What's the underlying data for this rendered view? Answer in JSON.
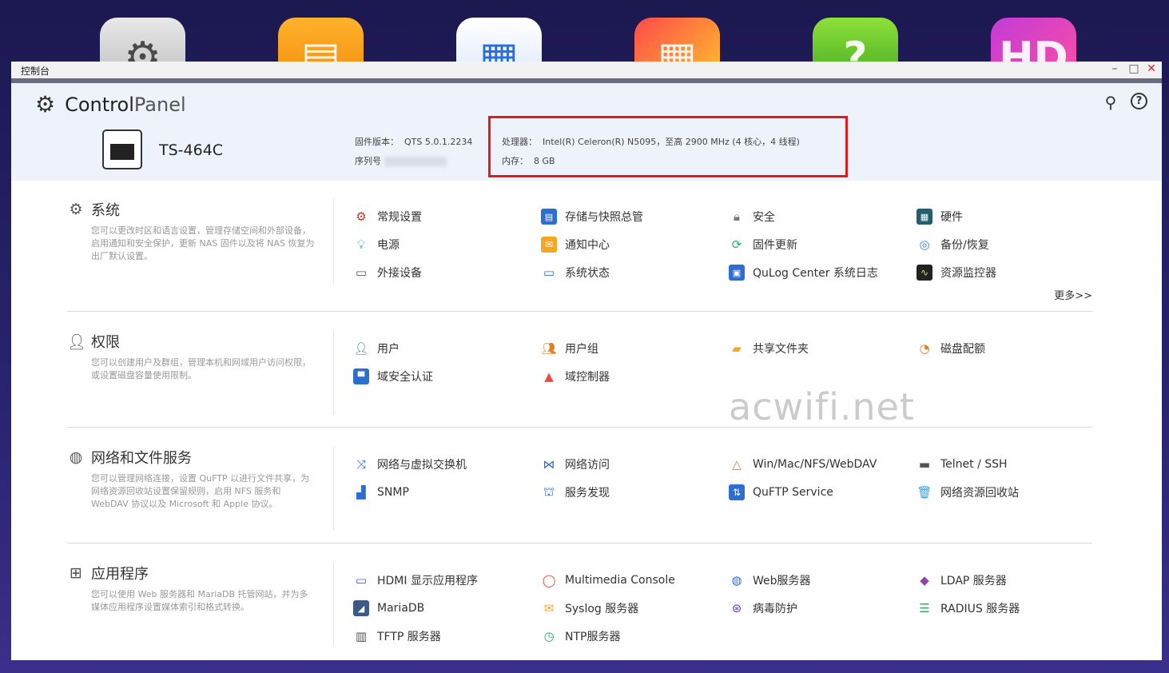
{
  "desktop": {
    "icons": [
      "gear-icon",
      "folder-icon",
      "storage-icon",
      "app-center-icon",
      "help-icon",
      "hd-icon"
    ],
    "glyphs": [
      "⚙",
      "▤",
      "▦",
      "▦",
      "?",
      "HD"
    ]
  },
  "window": {
    "title": "控制台",
    "min": "–",
    "max": "□",
    "close": "✕"
  },
  "header": {
    "brand_bold": "Control",
    "brand_light": "Panel",
    "device_name": "TS-464C",
    "fw_label": "固件版本：",
    "fw_value": "QTS 5.0.1.2234",
    "sn_label": "序列号",
    "cpu_label": "处理器：",
    "cpu_value": "Intel(R) Celeron(R) N5095，至高 2900 MHz (4 核心，4 线程)",
    "mem_label": "内存：",
    "mem_value": "8 GB"
  },
  "sections": [
    {
      "title": "系统",
      "desc": "您可以更改时区和语言设置，管理存储空间和外部设备，启用通知和安全保护，更新 NAS 固件以及将 NAS 恢复为出厂默认设置。",
      "items": [
        "常规设置",
        "存储与快照总管",
        "安全",
        "硬件",
        "电源",
        "通知中心",
        "固件更新",
        "备份/恢复",
        "外接设备",
        "系统状态",
        "QuLog Center 系统日志",
        "资源监控器"
      ],
      "more": "更多>>"
    },
    {
      "title": "权限",
      "desc": "您可以创建用户及群组，管理本机和网域用户访问权限，或设置磁盘容量使用限制。",
      "items": [
        "用户",
        "用户组",
        "共享文件夹",
        "磁盘配额",
        "域安全认证",
        "域控制器"
      ]
    },
    {
      "title": "网络和文件服务",
      "desc": "您可以管理网络连接，设置 QuFTP 以进行文件共享，为网络资源回收站设置保留规则，启用 NFS 服务和 WebDAV 协议以及 Microsoft 和 Apple 协议。",
      "items": [
        "网络与虚拟交换机",
        "网络访问",
        "Win/Mac/NFS/WebDAV",
        "Telnet / SSH",
        "SNMP",
        "服务发现",
        "QuFTP Service",
        "网络资源回收站"
      ]
    },
    {
      "title": "应用程序",
      "desc": "您可以使用 Web 服务器和 MariaDB 托管网站，并为多媒体应用程序设置媒体索引和格式转换。",
      "items": [
        "HDMI 显示应用程序",
        "Multimedia Console",
        "Web服务器",
        "LDAP 服务器",
        "MariaDB",
        "Syslog 服务器",
        "病毒防护",
        "RADIUS 服务器",
        "TFTP 服务器",
        "NTP服务器"
      ]
    }
  ],
  "watermark": "acwifi.net",
  "colors": {
    "highlight": "#e11a1a",
    "header_bg": "#eef3fb"
  }
}
